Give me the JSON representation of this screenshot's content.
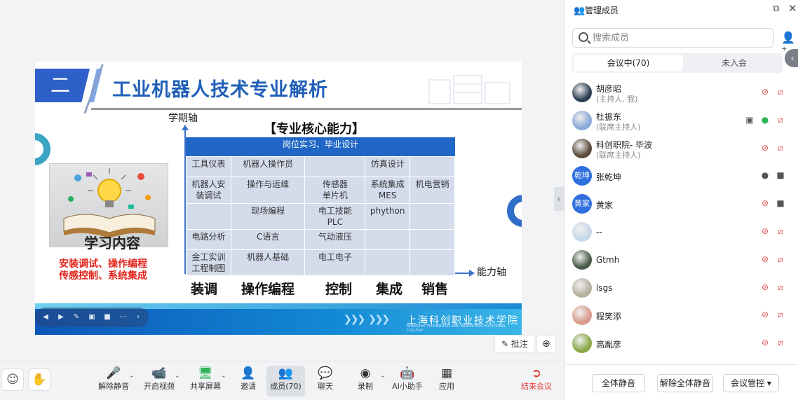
{
  "slide": {
    "number": "二",
    "title": "工业机器人技术专业解析",
    "y_axis_label": "学期轴",
    "x_axis_label": "能力轴",
    "core_title": "【专业核心能力】",
    "grid_header": "岗位实习、毕业设计",
    "grid_rows": [
      [
        "工具仪表",
        "机器人操作员",
        "",
        "仿真设计",
        ""
      ],
      [
        "机器人安装调试",
        "操作与运维",
        "传感器\n单片机",
        "系统集成\nMES",
        "机电营销"
      ],
      [
        "",
        "现场编程",
        "电工技能\nPLC",
        "phython",
        ""
      ],
      [
        "电路分析",
        "C语言",
        "气动液压",
        "",
        ""
      ],
      [
        "金工实训\n工程制图",
        "机器人基础",
        "电工电子",
        "",
        ""
      ]
    ],
    "bottom_labels": [
      "装调",
      "操作编程",
      "控制",
      "集成",
      "销售"
    ],
    "image_caption": "学习内容",
    "red_line_1": "安装调试、操作编程",
    "red_line_2": "传感控制、系统集成",
    "school_name": "上海科创职业技术学院",
    "school_name_en": "SHANGHAI TECHNOLOGY AND INNOVATION VOCATIONAL COLLEGE"
  },
  "annotate_label": "批注",
  "toolbar": {
    "items": [
      {
        "label": "解除静音",
        "icon": "mic-muted-icon"
      },
      {
        "label": "开启视频",
        "icon": "camera-off-icon"
      },
      {
        "label": "共享屏幕",
        "icon": "share-screen-icon"
      },
      {
        "label": "邀请",
        "icon": "invite-icon"
      },
      {
        "label": "成员(70)",
        "icon": "members-icon"
      },
      {
        "label": "聊天",
        "icon": "chat-icon"
      },
      {
        "label": "录制",
        "icon": "record-icon"
      },
      {
        "label": "AI小助手",
        "icon": "ai-assistant-icon"
      },
      {
        "label": "应用",
        "icon": "apps-icon"
      },
      {
        "label": "结束会议",
        "icon": "leave-icon"
      }
    ]
  },
  "panel": {
    "title": "管理成员",
    "search_placeholder": "搜索成员",
    "tab_in": "会议中(70)",
    "tab_out": "未入会",
    "members": [
      {
        "name": "胡彦昭",
        "role": "(主持人, 我)",
        "avatar": "",
        "mic": "muted",
        "cam": "off",
        "share": false
      },
      {
        "name": "杜振东",
        "role": "(联席主持人)",
        "avatar": "",
        "mic": "on",
        "cam": "off",
        "share": true
      },
      {
        "name": "科创职院- 毕波",
        "role": "(联席主持人)",
        "avatar": "",
        "mic": "muted",
        "cam": "off",
        "share": false
      },
      {
        "name": "张乾坤",
        "role": "",
        "avatar": "乾坤",
        "mic": "idle",
        "cam": "on",
        "share": false
      },
      {
        "name": "黄家",
        "role": "",
        "avatar": "黄家",
        "mic": "muted",
        "cam": "on",
        "share": false
      },
      {
        "name": "--",
        "role": "",
        "avatar": "",
        "mic": "muted",
        "cam": "off",
        "share": false
      },
      {
        "name": "Gtmh",
        "role": "",
        "avatar": "",
        "mic": "muted",
        "cam": "off",
        "share": false
      },
      {
        "name": "lsgs",
        "role": "",
        "avatar": "",
        "mic": "muted",
        "cam": "off",
        "share": false
      },
      {
        "name": "程笑添",
        "role": "",
        "avatar": "",
        "mic": "muted",
        "cam": "off",
        "share": false
      },
      {
        "name": "高胤彦",
        "role": "",
        "avatar": "",
        "mic": "muted",
        "cam": "off",
        "share": false
      }
    ],
    "mute_all": "全体静音",
    "unmute_all": "解除全体静音",
    "meeting_control": "会议管控"
  },
  "colors": {
    "accent": "#2f6fe0",
    "muted_red": "#e05050",
    "active_green": "#2fb35a",
    "slide_blue": "#1f66c6"
  }
}
